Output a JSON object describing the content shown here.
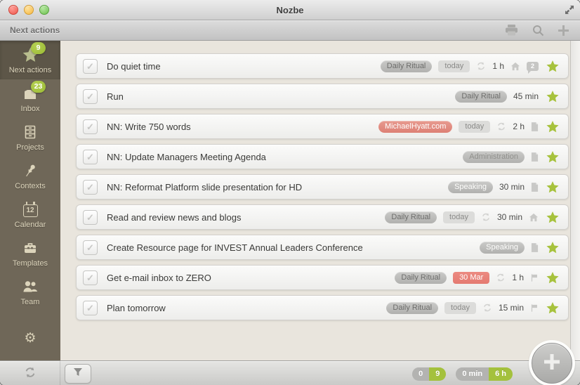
{
  "window": {
    "title": "Nozbe"
  },
  "toolbar": {
    "title": "Next actions"
  },
  "sidebar": {
    "items": [
      {
        "label": "Next actions",
        "badge": "9",
        "active": true
      },
      {
        "label": "Inbox",
        "badge": "23"
      },
      {
        "label": "Projects"
      },
      {
        "label": "Contexts"
      },
      {
        "label": "Calendar",
        "day": "12"
      },
      {
        "label": "Templates"
      },
      {
        "label": "Team"
      }
    ]
  },
  "tasks": [
    {
      "title": "Do quiet time",
      "project": "Daily Ritual",
      "project_class": "proj-gray",
      "due": "today",
      "due_class": "due-gray",
      "repeat": true,
      "duration": "1 h",
      "home": true,
      "comments": "2",
      "starred": true
    },
    {
      "title": "Run",
      "project": "Daily Ritual",
      "project_class": "proj-gray",
      "duration": "45 min",
      "starred": true
    },
    {
      "title": "NN: Write 750 words",
      "project": "MichaelHyatt.com",
      "project_class": "proj-red",
      "due": "today",
      "due_class": "due-gray",
      "repeat": true,
      "duration": "2 h",
      "note": true,
      "starred": true
    },
    {
      "title": "NN: Update Managers Meeting Agenda",
      "project": "Administration",
      "project_class": "proj-gray-light",
      "note": true,
      "starred": true
    },
    {
      "title": "NN: Reformat Platform slide presentation for HD",
      "project": "Speaking",
      "project_class": "proj-white",
      "duration": "30 min",
      "note": true,
      "starred": true
    },
    {
      "title": "Read and review news and blogs",
      "project": "Daily Ritual",
      "project_class": "proj-gray",
      "due": "today",
      "due_class": "due-gray",
      "repeat": true,
      "duration": "30 min",
      "home": true,
      "starred": true
    },
    {
      "title": "Create Resource page for INVEST Annual Leaders Conference",
      "project": "Speaking",
      "project_class": "proj-white",
      "note": true,
      "starred": true
    },
    {
      "title": "Get e-mail inbox to ZERO",
      "project": "Daily Ritual",
      "project_class": "proj-gray",
      "due": "30 Mar",
      "due_class": "due-red",
      "repeat": true,
      "duration": "1 h",
      "flag": true,
      "starred": true
    },
    {
      "title": "Plan tomorrow",
      "project": "Daily Ritual",
      "project_class": "proj-gray",
      "due": "today",
      "due_class": "due-gray",
      "repeat": true,
      "duration": "15 min",
      "flag": true,
      "starred": true
    }
  ],
  "statusbar": {
    "counts": [
      {
        "left": "0",
        "right": "9"
      },
      {
        "left": "0 min",
        "right": "6 h"
      }
    ]
  },
  "colors": {
    "accent_green": "#a4c13d",
    "badge_green": "#9aba33",
    "project_red": "#dd8075",
    "due_red": "#e47a71",
    "sidebar_brown": "#6f6758"
  }
}
